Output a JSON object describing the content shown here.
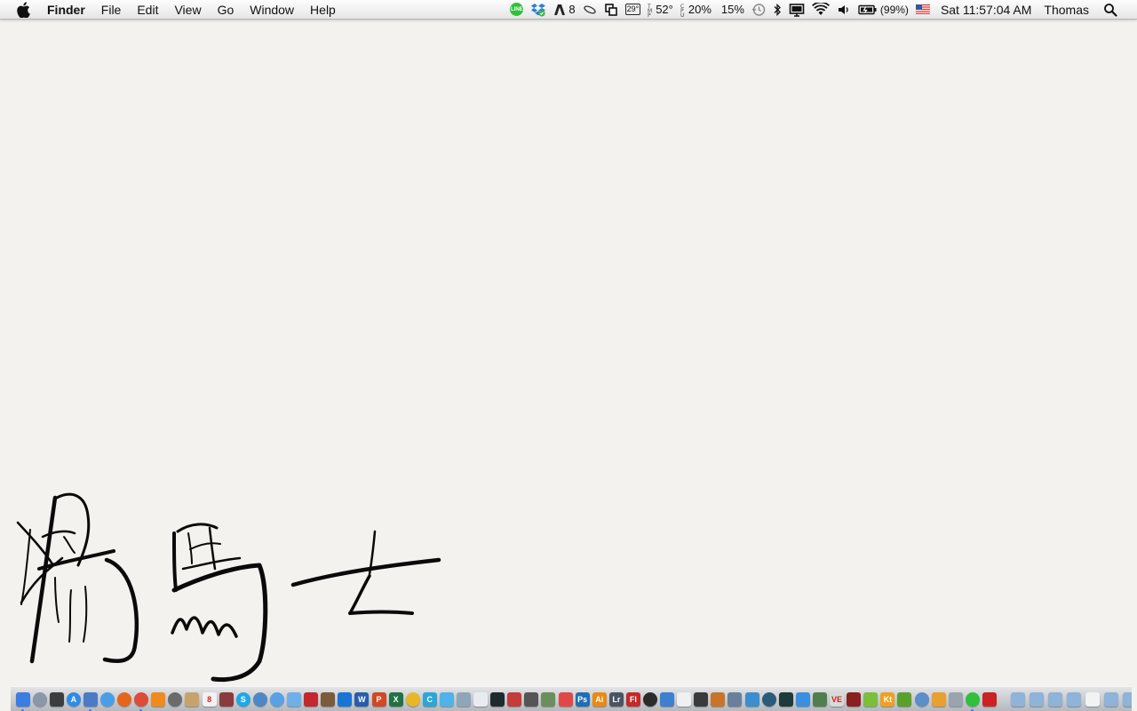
{
  "menubar": {
    "app_name": "Finder",
    "menus": [
      "File",
      "Edit",
      "View",
      "Go",
      "Window",
      "Help"
    ],
    "status": {
      "line_badge": "LINE",
      "adobe_count": "8",
      "temp_box": "29°",
      "temperature": "52°",
      "cpu_percent": "20%",
      "mem_percent": "15%",
      "battery": "(99%)",
      "clock": "Sat 11:57:04 AM",
      "user": "Thomas"
    }
  },
  "dock": {
    "apps": [
      {
        "name": "finder",
        "color": "#3b7de0",
        "label": "",
        "round": false,
        "running": true
      },
      {
        "name": "launchpad",
        "color": "#8b97a8",
        "label": "",
        "round": true,
        "running": false
      },
      {
        "name": "mission-control",
        "color": "#3d3d3d",
        "label": "",
        "round": false,
        "running": false
      },
      {
        "name": "app-store",
        "color": "#2e8de6",
        "label": "A",
        "round": true,
        "running": false
      },
      {
        "name": "preview",
        "color": "#4b7ac7",
        "label": "",
        "round": false,
        "running": true
      },
      {
        "name": "safari",
        "color": "#4a9ee8",
        "label": "",
        "round": true,
        "running": false
      },
      {
        "name": "firefox",
        "color": "#e4661b",
        "label": "",
        "round": true,
        "running": false
      },
      {
        "name": "chrome",
        "color": "#dd4b39",
        "label": "",
        "round": true,
        "running": true
      },
      {
        "name": "vlc",
        "color": "#f08a1c",
        "label": "",
        "round": false,
        "running": false
      },
      {
        "name": "camera",
        "color": "#6a6a6a",
        "label": "",
        "round": true,
        "running": false
      },
      {
        "name": "notes",
        "color": "#c7a36b",
        "label": "",
        "round": false,
        "running": false
      },
      {
        "name": "calendar",
        "color": "#f2f2f2",
        "label": "8",
        "round": false,
        "running": false
      },
      {
        "name": "photo-booth",
        "color": "#8a3b3b",
        "label": "",
        "round": false,
        "running": false
      },
      {
        "name": "skype",
        "color": "#1fa7e8",
        "label": "S",
        "round": true,
        "running": false
      },
      {
        "name": "system-info",
        "color": "#4d88c4",
        "label": "",
        "round": true,
        "running": false
      },
      {
        "name": "messages",
        "color": "#5aa0e6",
        "label": "",
        "round": true,
        "running": false
      },
      {
        "name": "mail",
        "color": "#6fb0e8",
        "label": "",
        "round": false,
        "running": false
      },
      {
        "name": "flashcards",
        "color": "#c2282c",
        "label": "",
        "round": false,
        "running": false
      },
      {
        "name": "photos",
        "color": "#7b5b3b",
        "label": "",
        "round": false,
        "running": false
      },
      {
        "name": "teamviewer",
        "color": "#1a74d6",
        "label": "",
        "round": false,
        "running": false
      },
      {
        "name": "word",
        "color": "#2a5caa",
        "label": "W",
        "round": false,
        "running": false
      },
      {
        "name": "powerpoint",
        "color": "#d24726",
        "label": "P",
        "round": false,
        "running": false
      },
      {
        "name": "excel",
        "color": "#207245",
        "label": "X",
        "round": false,
        "running": false
      },
      {
        "name": "coin",
        "color": "#e7b72a",
        "label": "",
        "round": true,
        "running": false
      },
      {
        "name": "c-app",
        "color": "#2aa7d8",
        "label": "C",
        "round": false,
        "running": false
      },
      {
        "name": "dropbox-bird",
        "color": "#4fb3e8",
        "label": "",
        "round": false,
        "running": false
      },
      {
        "name": "tools",
        "color": "#8fa6b8",
        "label": "",
        "round": false,
        "running": false
      },
      {
        "name": "document",
        "color": "#e8ecf0",
        "label": "",
        "round": false,
        "running": false
      },
      {
        "name": "terminal",
        "color": "#1e2b2b",
        "label": "",
        "round": false,
        "running": false
      },
      {
        "name": "presentation",
        "color": "#c43c3c",
        "label": "",
        "round": false,
        "running": false
      },
      {
        "name": "media",
        "color": "#555555",
        "label": "",
        "round": false,
        "running": false
      },
      {
        "name": "contacts",
        "color": "#6b8e5a",
        "label": "",
        "round": false,
        "running": false
      },
      {
        "name": "cross",
        "color": "#e04848",
        "label": "",
        "round": false,
        "running": false
      },
      {
        "name": "photoshop",
        "color": "#1f6fb2",
        "label": "Ps",
        "round": false,
        "running": false
      },
      {
        "name": "illustrator",
        "color": "#e88a14",
        "label": "Ai",
        "round": false,
        "running": false
      },
      {
        "name": "lightroom",
        "color": "#4a5563",
        "label": "Lr",
        "round": false,
        "running": false
      },
      {
        "name": "flash",
        "color": "#c42a2a",
        "label": "Fl",
        "round": false,
        "running": false
      },
      {
        "name": "dvd",
        "color": "#2b2b2b",
        "label": "",
        "round": true,
        "running": false
      },
      {
        "name": "keynote",
        "color": "#3f7fd0",
        "label": "",
        "round": false,
        "running": false
      },
      {
        "name": "textedit",
        "color": "#f0f0f0",
        "label": "",
        "round": false,
        "running": false
      },
      {
        "name": "screen",
        "color": "#3a3a3a",
        "label": "",
        "round": false,
        "running": false
      },
      {
        "name": "gift",
        "color": "#c8742a",
        "label": "",
        "round": false,
        "running": false
      },
      {
        "name": "pen",
        "color": "#6a7f9b",
        "label": "",
        "round": false,
        "running": false
      },
      {
        "name": "chart",
        "color": "#3b8fcf",
        "label": "",
        "round": false,
        "running": false
      },
      {
        "name": "globe",
        "color": "#2c5a7a",
        "label": "",
        "round": true,
        "running": false
      },
      {
        "name": "stocks",
        "color": "#1e3a3a",
        "label": "",
        "round": false,
        "running": false
      },
      {
        "name": "dropbox",
        "color": "#3a8fe0",
        "label": "",
        "round": false,
        "running": false
      },
      {
        "name": "printer",
        "color": "#4f7f4f",
        "label": "",
        "round": false,
        "running": false
      },
      {
        "name": "ve",
        "color": "#d9d9d9",
        "label": "VE",
        "round": false,
        "running": false
      },
      {
        "name": "books",
        "color": "#8a1f1f",
        "label": "",
        "round": false,
        "running": false
      },
      {
        "name": "android",
        "color": "#7bbf3a",
        "label": "",
        "round": false,
        "running": false
      },
      {
        "name": "kt",
        "color": "#f0a020",
        "label": "Kt",
        "round": false,
        "running": false
      },
      {
        "name": "bottle",
        "color": "#5aa02c",
        "label": "",
        "round": false,
        "running": false
      },
      {
        "name": "migration",
        "color": "#5c8ec8",
        "label": "",
        "round": true,
        "running": false
      },
      {
        "name": "draw",
        "color": "#e8a030",
        "label": "",
        "round": false,
        "running": false
      },
      {
        "name": "utility",
        "color": "#9aa4ae",
        "label": "",
        "round": false,
        "running": false
      },
      {
        "name": "line-app",
        "color": "#2fc13a",
        "label": "",
        "round": true,
        "running": true
      },
      {
        "name": "pdf",
        "color": "#c22",
        "label": "",
        "round": false,
        "running": false
      }
    ],
    "stacks": [
      {
        "name": "folder-stack-1",
        "color": "#8fb3d9"
      },
      {
        "name": "folder-stack-2",
        "color": "#8fb3d9"
      },
      {
        "name": "folder-stack-3",
        "color": "#8fb3d9"
      },
      {
        "name": "folder-stack-4",
        "color": "#8fb3d9"
      },
      {
        "name": "document-stack",
        "color": "#f2f2f2"
      },
      {
        "name": "folder-stack-5",
        "color": "#8fb3d9"
      },
      {
        "name": "folder-stack-6",
        "color": "#8fb3d9"
      },
      {
        "name": "trash",
        "color": "#b0b6bd"
      }
    ]
  },
  "colors": {
    "desktop": "#f4f2ee",
    "ink": "#0a0a0a"
  }
}
